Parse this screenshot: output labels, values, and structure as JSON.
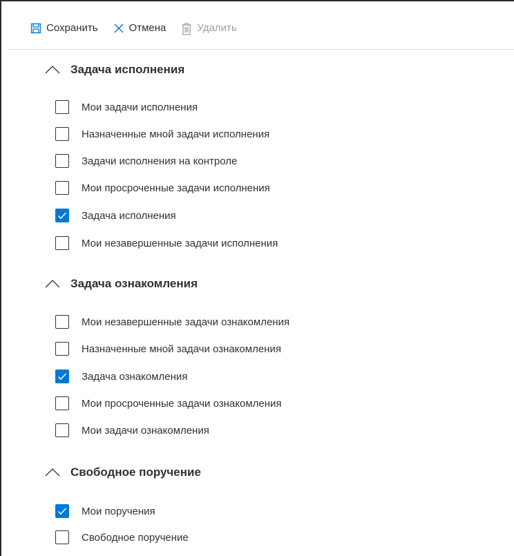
{
  "toolbar": {
    "save_label": "Сохранить",
    "cancel_label": "Отмена",
    "delete_label": "Удалить",
    "delete_disabled": true,
    "accent_color": "#0078d4"
  },
  "sections": [
    {
      "title": "Задача исполнения",
      "expanded": true,
      "items": [
        {
          "label": "Мои задачи исполнения",
          "checked": false
        },
        {
          "label": "Назначенные мной задачи исполнения",
          "checked": false
        },
        {
          "label": "Задачи исполнения на контроле",
          "checked": false
        },
        {
          "label": "Мои просроченные задачи исполнения",
          "checked": false
        },
        {
          "label": "Задача исполнения",
          "checked": true
        },
        {
          "label": "Мои незавершенные задачи исполнения",
          "checked": false
        }
      ]
    },
    {
      "title": "Задача ознакомления",
      "expanded": true,
      "items": [
        {
          "label": "Мои незавершенные задачи ознакомления",
          "checked": false
        },
        {
          "label": "Назначенные мной задачи ознакомления",
          "checked": false
        },
        {
          "label": "Задача ознакомления",
          "checked": true
        },
        {
          "label": "Мои просроченные задачи ознакомления",
          "checked": false
        },
        {
          "label": "Мои задачи ознакомления",
          "checked": false
        }
      ]
    },
    {
      "title": "Свободное поручение",
      "expanded": true,
      "items": [
        {
          "label": "Мои поручения",
          "checked": true
        },
        {
          "label": "Свободное поручение",
          "checked": false
        }
      ]
    }
  ]
}
